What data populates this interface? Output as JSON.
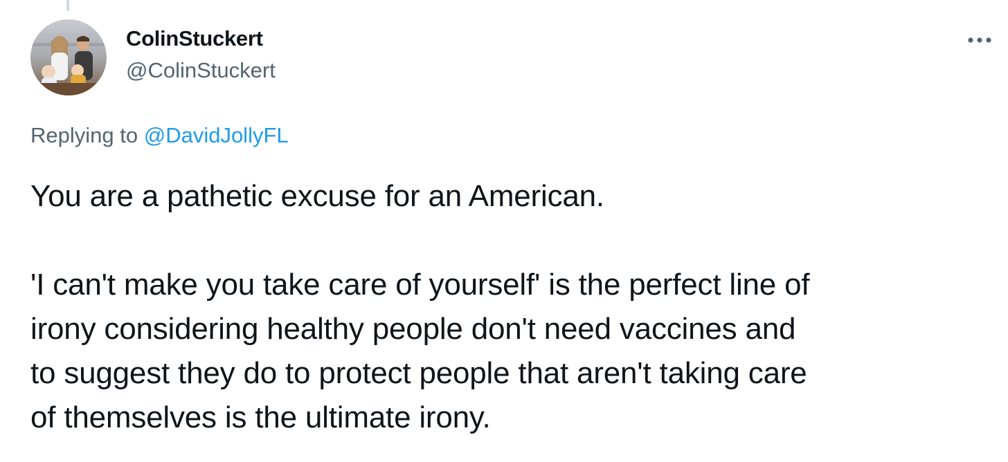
{
  "tweet": {
    "author": {
      "display_name": "ColinStuckert",
      "handle": "@ColinStuckert",
      "avatar_icon": "user-avatar-photo"
    },
    "more_icon": "more-horizontal-icon",
    "reply_context": {
      "prefix": "Replying to",
      "mention": "@DavidJollyFL"
    },
    "text_lines": [
      "You are a pathetic excuse for an American.",
      "'I can't make you take care of yourself' is the perfect line of",
      "irony considering healthy people don't need vaccines and",
      "to suggest they do to protect people that aren't taking care",
      "of themselves is the ultimate irony."
    ]
  },
  "colors": {
    "text_primary": "#0f1419",
    "text_secondary": "#536471",
    "link": "#1d9bf0",
    "thread_line": "#cfd9de"
  }
}
